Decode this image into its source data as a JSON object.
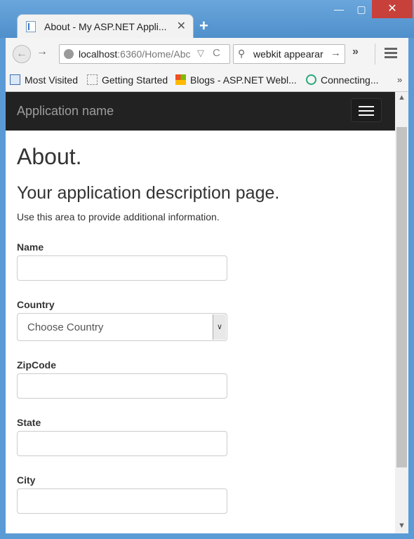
{
  "browser": {
    "tab_title": "About - My ASP.NET Appli...",
    "tab_close": "✕",
    "new_tab": "+",
    "window_buttons": {
      "minimize": "—",
      "maximize": "▢",
      "close": "✕"
    },
    "back": "←",
    "forward": "→",
    "url_host": "localhost",
    "url_rest": ":6360/Home/Abc",
    "url_drop": "▽",
    "reload": "C",
    "search_value": "webkit appearar",
    "search_go": "→",
    "overflow": "»",
    "bookmarks": {
      "items": [
        {
          "label": "Most Visited",
          "icon": "bookmark-icon"
        },
        {
          "label": "Getting Started",
          "icon": "page-icon"
        },
        {
          "label": "Blogs - ASP.NET Webl...",
          "icon": "windows-logo-icon"
        },
        {
          "label": "Connecting...",
          "icon": "spinner-icon"
        }
      ],
      "more": "»"
    }
  },
  "page": {
    "brand": "Application name",
    "heading": "About.",
    "subheading": "Your application description page.",
    "description": "Use this area to provide additional information.",
    "form": {
      "name_label": "Name",
      "country_label": "Country",
      "country_selected": "Choose Country",
      "zipcode_label": "ZipCode",
      "state_label": "State",
      "city_label": "City"
    }
  },
  "colors": {
    "navbar": "#222222",
    "brand_text": "#9d9d9d",
    "close_button": "#c7413a",
    "title_bar": "#5b9bd5"
  }
}
